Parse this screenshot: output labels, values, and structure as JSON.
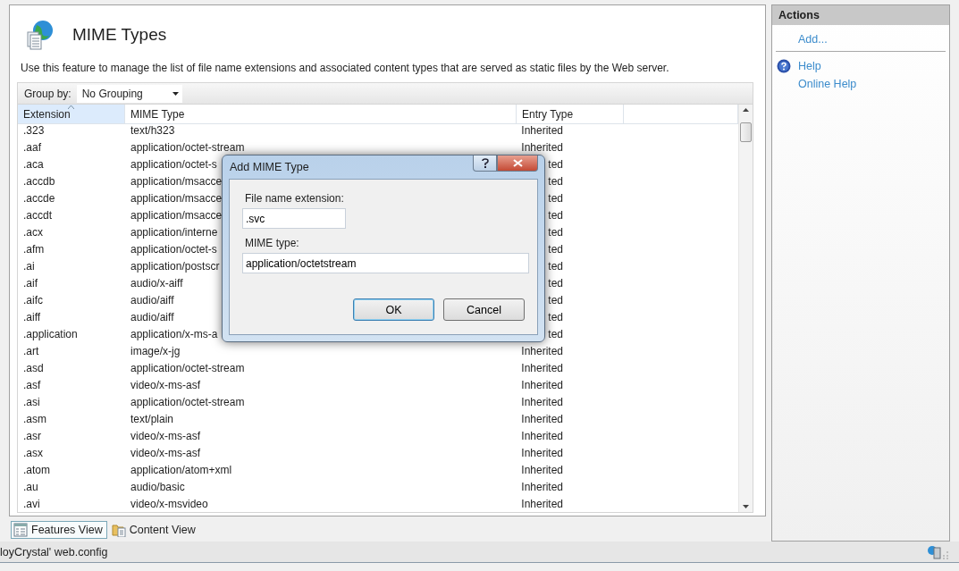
{
  "page": {
    "title": "MIME Types",
    "description": "Use this feature to manage the list of file name extensions and associated content types that are served as static files by the Web server."
  },
  "group_by": {
    "label": "Group by:",
    "value": "No Grouping"
  },
  "table": {
    "columns": [
      {
        "label": "Extension",
        "sorted": true
      },
      {
        "label": "MIME Type",
        "sorted": false
      },
      {
        "label": "Entry Type",
        "sorted": false
      },
      {
        "sorted": false
      }
    ],
    "rows": [
      {
        "extension": ".323",
        "mime": "text/h323",
        "entry": "Inherited"
      },
      {
        "extension": ".aaf",
        "mime": "application/octet-stream",
        "entry": "Inherited"
      },
      {
        "extension": ".aca",
        "mime": "application/octet-s",
        "entry": "ted"
      },
      {
        "extension": ".accdb",
        "mime": "application/msacce",
        "entry": "ted"
      },
      {
        "extension": ".accde",
        "mime": "application/msacce",
        "entry": "ted"
      },
      {
        "extension": ".accdt",
        "mime": "application/msacce",
        "entry": "ted"
      },
      {
        "extension": ".acx",
        "mime": "application/interne",
        "entry": "ted"
      },
      {
        "extension": ".afm",
        "mime": "application/octet-s",
        "entry": "ted"
      },
      {
        "extension": ".ai",
        "mime": "application/postscr",
        "entry": "ted"
      },
      {
        "extension": ".aif",
        "mime": "audio/x-aiff",
        "entry": "ted"
      },
      {
        "extension": ".aifc",
        "mime": "audio/aiff",
        "entry": "ted"
      },
      {
        "extension": ".aiff",
        "mime": "audio/aiff",
        "entry": "ted"
      },
      {
        "extension": ".application",
        "mime": "application/x-ms-a",
        "entry": "ted"
      },
      {
        "extension": ".art",
        "mime": "image/x-jg",
        "entry": "Inherited"
      },
      {
        "extension": ".asd",
        "mime": "application/octet-stream",
        "entry": "Inherited"
      },
      {
        "extension": ".asf",
        "mime": "video/x-ms-asf",
        "entry": "Inherited"
      },
      {
        "extension": ".asi",
        "mime": "application/octet-stream",
        "entry": "Inherited"
      },
      {
        "extension": ".asm",
        "mime": "text/plain",
        "entry": "Inherited"
      },
      {
        "extension": ".asr",
        "mime": "video/x-ms-asf",
        "entry": "Inherited"
      },
      {
        "extension": ".asx",
        "mime": "video/x-ms-asf",
        "entry": "Inherited"
      },
      {
        "extension": ".atom",
        "mime": "application/atom+xml",
        "entry": "Inherited"
      },
      {
        "extension": ".au",
        "mime": "audio/basic",
        "entry": "Inherited"
      },
      {
        "extension": ".avi",
        "mime": "video/x-msvideo",
        "entry": "Inherited"
      }
    ]
  },
  "views": [
    {
      "label": "Features View",
      "selected": true,
      "kind": "features"
    },
    {
      "label": "Content View",
      "selected": false,
      "kind": "content"
    }
  ],
  "status_bar": {
    "text": "loyCrystal' web.config"
  },
  "actions": {
    "title": "Actions",
    "groups": [
      [
        {
          "label": "Add...",
          "kind": "plain"
        }
      ],
      [
        {
          "label": "Help",
          "kind": "help"
        },
        {
          "label": "Online Help",
          "kind": "plain"
        }
      ]
    ]
  },
  "dialog": {
    "title": "Add MIME Type",
    "fields": [
      {
        "label": "File name extension:",
        "value": ".svc",
        "kind": "short"
      },
      {
        "label": "MIME type:",
        "value": "application/octetstream",
        "kind": "wide"
      }
    ],
    "buttons": [
      {
        "label": "OK",
        "selected": true
      },
      {
        "label": "Cancel",
        "selected": false
      }
    ]
  }
}
